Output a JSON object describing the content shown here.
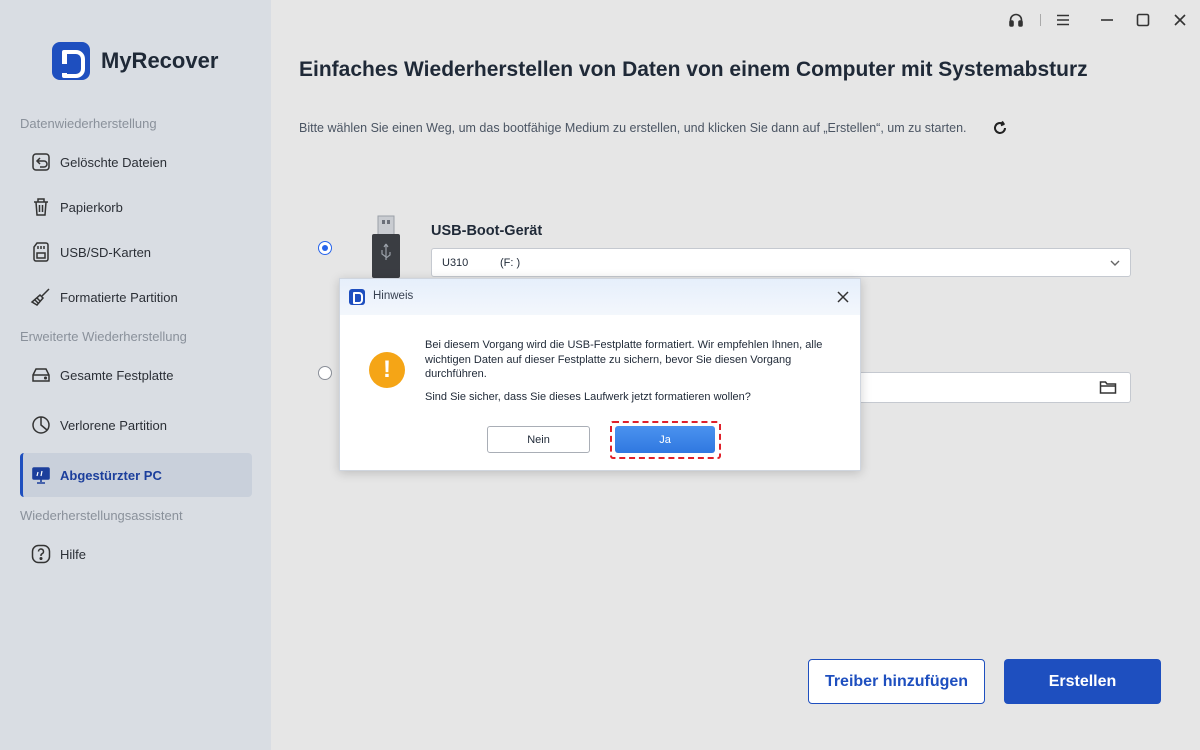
{
  "app": {
    "name": "MyRecover"
  },
  "sidebar": {
    "sections": [
      "Datenwiederherstellung",
      "Erweiterte Wiederherstellung",
      "Wiederherstellungsassistent"
    ],
    "items": [
      {
        "label": "Gelöschte Dateien",
        "icon": "undo-file-icon"
      },
      {
        "label": "Papierkorb",
        "icon": "trash-icon"
      },
      {
        "label": "USB/SD-Karten",
        "icon": "sd-card-icon"
      },
      {
        "label": "Formatierte Partition",
        "icon": "broom-icon"
      },
      {
        "label": "Gesamte Festplatte",
        "icon": "hard-drive-icon"
      },
      {
        "label": "Verlorene Partition",
        "icon": "partition-icon"
      },
      {
        "label": "Abgestürzter PC",
        "icon": "crashed-pc-icon",
        "active": true
      },
      {
        "label": "Hilfe",
        "icon": "help-icon"
      }
    ]
  },
  "main": {
    "title": "Einfaches Wiederherstellen von Daten von einem Computer mit Systemabsturz",
    "subtitle": "Bitte wählen Sie einen Weg, um das bootfähige Medium zu erstellen, und klicken Sie dann auf „Erstellen“, um zu starten.",
    "usb_option": {
      "label": "USB-Boot-Gerät",
      "selected": true,
      "device_name": "U310",
      "device_letter": "(F: )"
    },
    "iso_option": {
      "selected": false
    },
    "buttons": {
      "add_driver": "Treiber hinzufügen",
      "create": "Erstellen"
    }
  },
  "dialog": {
    "title": "Hinweis",
    "message": "Bei diesem Vorgang wird die USB-Festplatte formatiert. Wir empfehlen Ihnen, alle wichtigen Daten auf dieser Festplatte zu sichern, bevor Sie diesen Vorgang durchführen.",
    "confirm": "Sind Sie sicher, dass Sie dieses Laufwerk jetzt formatieren wollen?",
    "no_label": "Nein",
    "yes_label": "Ja"
  },
  "colors": {
    "accent": "#1e4fbf",
    "warning": "#f5a516",
    "highlight": "#e0202a"
  }
}
